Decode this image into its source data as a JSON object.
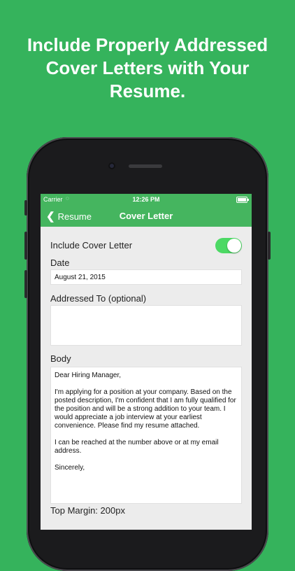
{
  "headline": {
    "line1": "Include Properly Addressed",
    "line2": "Cover Letters with Your",
    "line3": "Resume."
  },
  "status_bar": {
    "carrier": "Carrier",
    "time": "12:26 PM"
  },
  "nav": {
    "back_label": "Resume",
    "title": "Cover Letter"
  },
  "form": {
    "include_label": "Include Cover Letter",
    "include_enabled": true,
    "date_label": "Date",
    "date_value": "August 21, 2015",
    "addressed_label": "Addressed To (optional)",
    "addressed_value": "",
    "body_label": "Body",
    "body_value": "Dear Hiring Manager,\n\nI'm applying for a position at your company. Based on the posted description, I'm confident that I am fully qualified for the position and will be a strong addition to your team. I would appreciate a job interview at your earliest convenience. Please find my resume attached.\n\nI can be reached at the number above or at my email address.\n\nSincerely,",
    "top_margin_label": "Top Margin: 200px"
  },
  "colors": {
    "background": "#35b35c",
    "nav": "#45b55f",
    "switch_on": "#4cd964"
  }
}
